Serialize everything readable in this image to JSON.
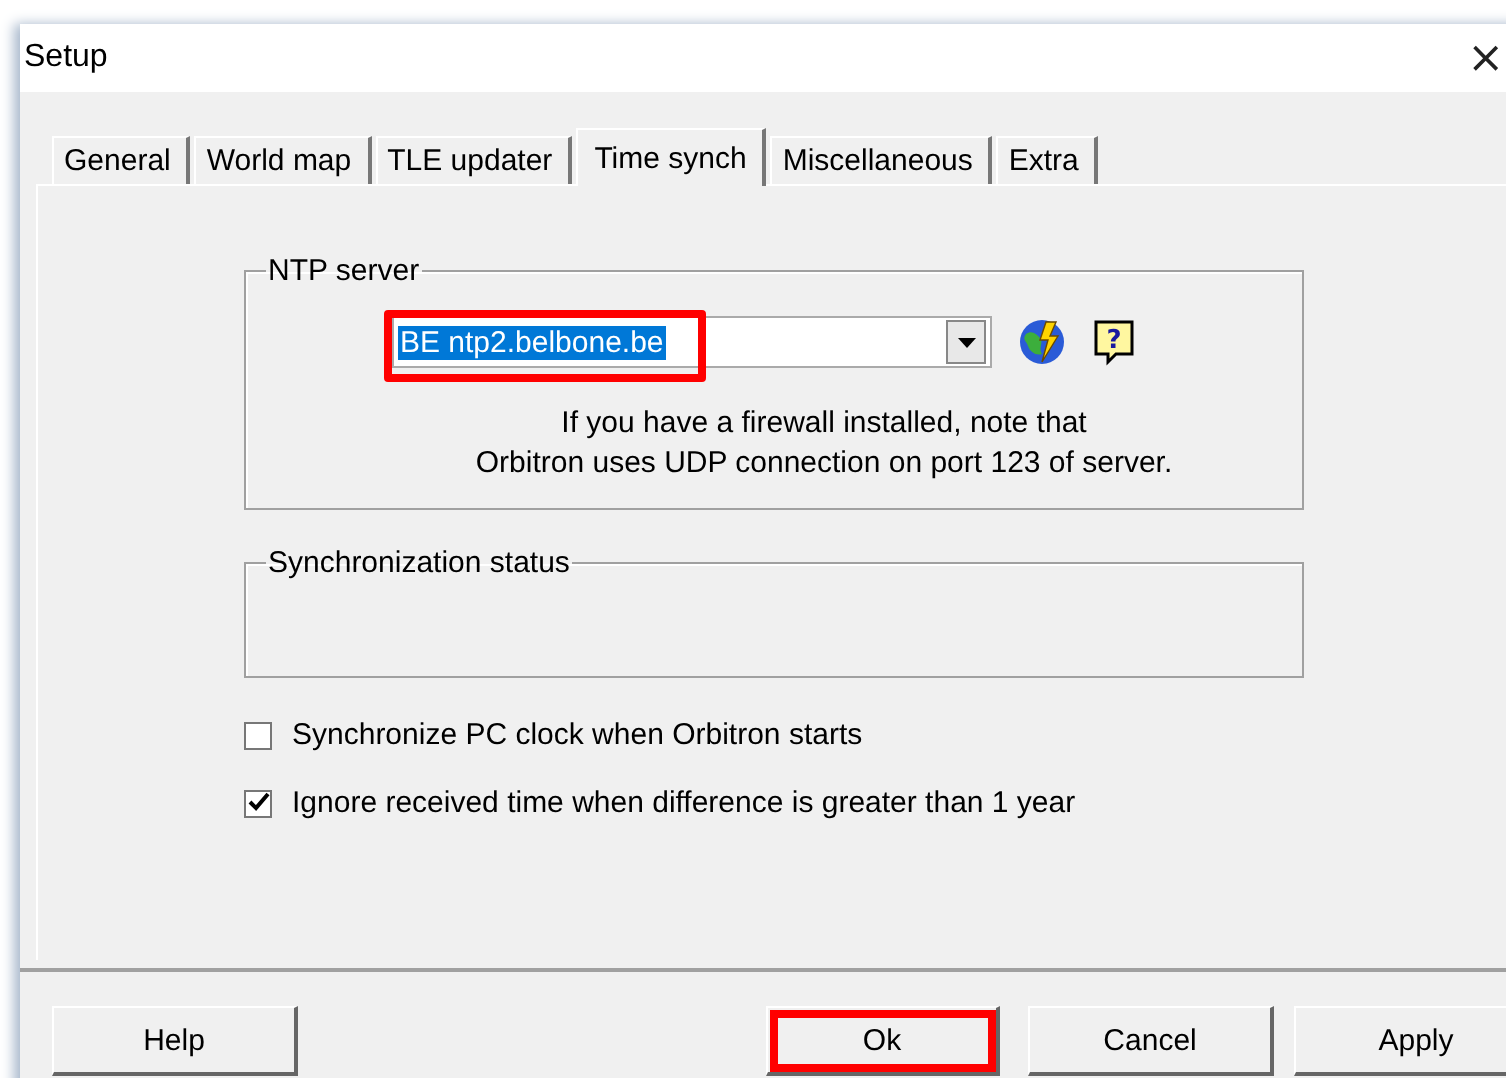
{
  "window": {
    "title": "Setup",
    "close": "×"
  },
  "tabs": [
    {
      "label": "General",
      "selected": false
    },
    {
      "label": "World map",
      "selected": false
    },
    {
      "label": "TLE updater",
      "selected": false
    },
    {
      "label": "Time synch",
      "selected": true
    },
    {
      "label": "Miscellaneous",
      "selected": false
    },
    {
      "label": "Extra",
      "selected": false
    }
  ],
  "ntp_server": {
    "title": "NTP server",
    "value": "BE ntp2.belbone.be",
    "highlighted": true,
    "help_glyph": "?",
    "note": [
      "If you have a firewall installed, note that",
      "Orbitron uses UDP connection on port 123 of server."
    ]
  },
  "sync_status": {
    "title": "Synchronization status"
  },
  "options": [
    {
      "label": "Synchronize PC clock when Orbitron starts",
      "checked": false
    },
    {
      "label": "Ignore received time when difference is greater than 1 year",
      "checked": true
    }
  ],
  "buttons": [
    {
      "label": "Help",
      "highlighted": false
    },
    {
      "label": "Ok",
      "highlighted": true
    },
    {
      "label": "Cancel",
      "highlighted": false
    },
    {
      "label": "Apply",
      "highlighted": false
    }
  ]
}
